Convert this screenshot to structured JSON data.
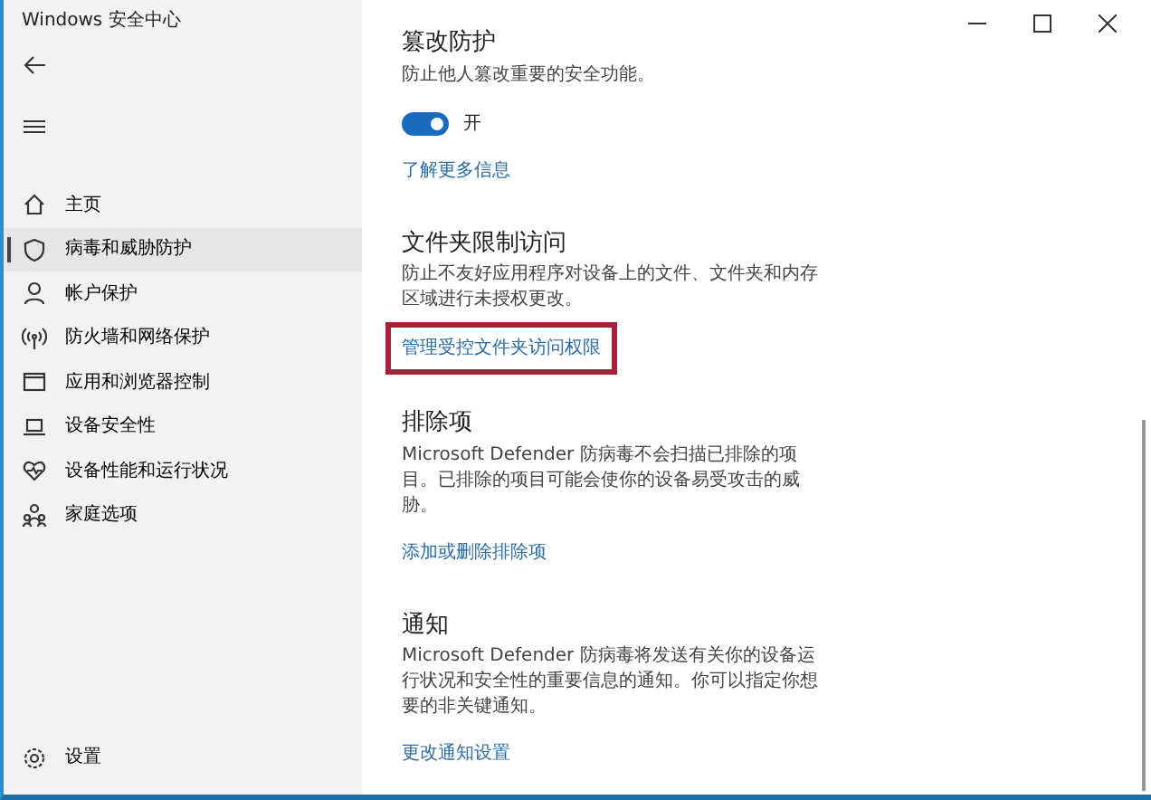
{
  "window": {
    "title": "Windows 安全中心"
  },
  "sidebar": {
    "items": [
      {
        "label": "主页",
        "selected": false
      },
      {
        "label": "病毒和威胁防护",
        "selected": true
      },
      {
        "label": "帐户保护",
        "selected": false
      },
      {
        "label": "防火墙和网络保护",
        "selected": false
      },
      {
        "label": "应用和浏览器控制",
        "selected": false
      },
      {
        "label": "设备安全性",
        "selected": false
      },
      {
        "label": "设备性能和运行状况",
        "selected": false
      },
      {
        "label": "家庭选项",
        "selected": false
      }
    ],
    "settings": {
      "label": "设置"
    }
  },
  "sections": [
    {
      "title": "篡改防护",
      "description": "防止他人篡改重要的安全功能。",
      "toggle": {
        "on": true,
        "label": "开"
      },
      "link": {
        "label": "了解更多信息",
        "highlighted": false
      }
    },
    {
      "title": "文件夹限制访问",
      "description": "防止不友好应用程序对设备上的文件、文件夹和内存区域进行未授权更改。",
      "link": {
        "label": "管理受控文件夹访问权限",
        "highlighted": true
      }
    },
    {
      "title": "排除项",
      "description": "Microsoft Defender 防病毒不会扫描已排除的项目。已排除的项目可能会使你的设备易受攻击的威胁。",
      "link": {
        "label": "添加或删除排除项",
        "highlighted": false
      }
    },
    {
      "title": "通知",
      "description": "Microsoft Defender 防病毒将发送有关你的设备运行状况和安全性的重要信息的通知。你可以指定你想要的非关键通知。",
      "link": {
        "label": "更改通知设置",
        "highlighted": false
      }
    }
  ]
}
